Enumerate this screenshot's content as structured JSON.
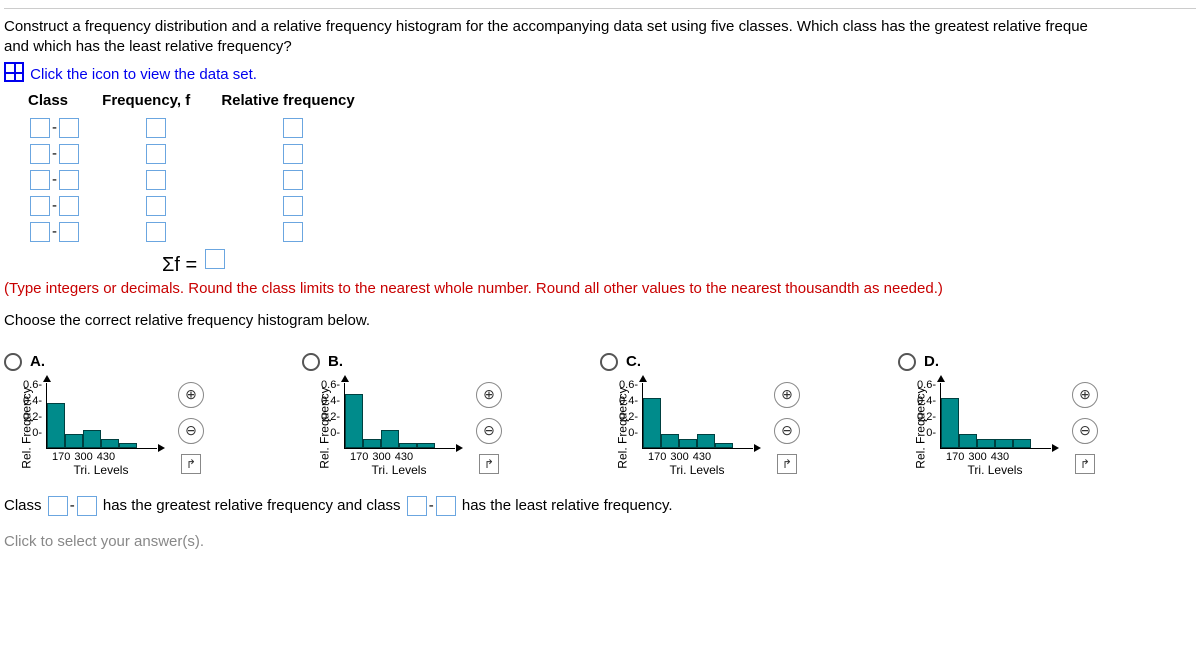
{
  "question": {
    "line1": "Construct a frequency distribution and a relative frequency histogram for the accompanying data set using five classes. Which class has the greatest relative freque",
    "line2": "and which has the least relative frequency?",
    "dataset_link": "Click the icon to view the data set."
  },
  "table_headers": {
    "class": "Class",
    "freq": "Frequency, f",
    "rel": "Relative frequency"
  },
  "sum_prefix": "Σf =",
  "type_instructions": "(Type integers or decimals. Round the class limits to the nearest whole number. Round all other values to the nearest thousandth as needed.)",
  "choose_prompt": "Choose the correct relative frequency histogram below.",
  "options": [
    {
      "label": "A."
    },
    {
      "label": "B."
    },
    {
      "label": "C."
    },
    {
      "label": "D."
    }
  ],
  "axis": {
    "y": "Rel. Frequency",
    "yticks": [
      "0.6",
      "0.4",
      "0.2",
      "0"
    ],
    "x": "Tri. Levels",
    "xticks": [
      "170",
      "300",
      "430"
    ]
  },
  "chart_data": [
    {
      "type": "bar",
      "title": "A",
      "categories": [
        "c1",
        "c2",
        "c3",
        "c4",
        "c5"
      ],
      "values": [
        0.5,
        0.15,
        0.2,
        0.1,
        0.05
      ],
      "xlabel": "Tri. Levels",
      "ylabel": "Rel. Frequency",
      "ylim": [
        0,
        0.7
      ],
      "xticks": [
        170,
        300,
        430
      ]
    },
    {
      "type": "bar",
      "title": "B",
      "categories": [
        "c1",
        "c2",
        "c3",
        "c4",
        "c5"
      ],
      "values": [
        0.6,
        0.1,
        0.2,
        0.05,
        0.05
      ],
      "xlabel": "Tri. Levels",
      "ylabel": "Rel. Frequency",
      "ylim": [
        0,
        0.7
      ],
      "xticks": [
        170,
        300,
        430
      ]
    },
    {
      "type": "bar",
      "title": "C",
      "categories": [
        "c1",
        "c2",
        "c3",
        "c4",
        "c5"
      ],
      "values": [
        0.55,
        0.15,
        0.1,
        0.15,
        0.05
      ],
      "xlabel": "Tri. Levels",
      "ylabel": "Rel. Frequency",
      "ylim": [
        0,
        0.7
      ],
      "xticks": [
        170,
        300,
        430
      ]
    },
    {
      "type": "bar",
      "title": "D",
      "categories": [
        "c1",
        "c2",
        "c3",
        "c4",
        "c5"
      ],
      "values": [
        0.55,
        0.15,
        0.1,
        0.1,
        0.1
      ],
      "xlabel": "Tri. Levels",
      "ylabel": "Rel. Frequency",
      "ylim": [
        0,
        0.7
      ],
      "xticks": [
        170,
        300,
        430
      ]
    }
  ],
  "final": {
    "p1": "Class",
    "p2": "has the greatest relative frequency and class",
    "p3": "has the least relative frequency."
  },
  "footer": "Click to select your answer(s).",
  "icons": {
    "zoom_in": "⊕",
    "zoom_out": "⊖",
    "popout": "↱",
    "dash": "-"
  }
}
